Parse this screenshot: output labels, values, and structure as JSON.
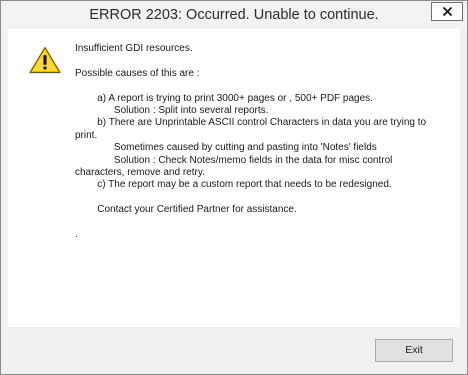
{
  "dialog": {
    "title": "ERROR 2203: Occurred. Unable to continue.",
    "icon": "warning-icon",
    "message": "Insufficient GDI resources.\n\nPossible causes of this are :\n\n        a) A report is trying to print 3000+ pages or , 500+ PDF pages.\n              Solution : Split into several reports.\n        b) There are Unprintable ASCII control Characters in data you are trying to\nprint.\n              Sometimes caused by cutting and pasting into 'Notes' fields\n              Solution : Check Notes/memo fields in the data for misc control\ncharacters, remove and retry.\n        c) The report may be a custom report that needs to be redesigned.\n\n        Contact your Certified Partner for assistance.\n\n.",
    "exit_label": "Exit",
    "close_label": "✕"
  },
  "colors": {
    "warning_fill": "#f5c400",
    "warning_border": "#6b5a00",
    "button_bg": "#e1e1e1"
  }
}
